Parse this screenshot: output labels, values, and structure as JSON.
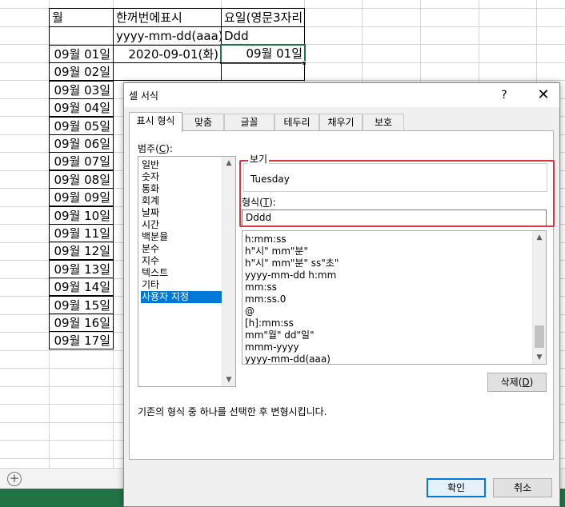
{
  "sheet": {
    "header_row": [
      "월",
      "한꺼번에표시",
      "요일(영문3자리)"
    ],
    "format_row": [
      "",
      "yyyy-mm-dd(aaa)",
      "Ddd"
    ],
    "dates": [
      "09월 01일",
      "09월 02일",
      "09월 03일",
      "09월 04일",
      "09월 05일",
      "09월 06일",
      "09월 07일",
      "09월 08일",
      "09월 09일",
      "09월 10일",
      "09월 11일",
      "09월 12일",
      "09월 13일",
      "09월 14일",
      "09월 15일",
      "09월 16일",
      "09월 17일"
    ],
    "row1_combined": "2020-09-01(화)",
    "row1_weekday": "09월 01일",
    "add_sheet_icon": "+"
  },
  "dialog": {
    "title": "셀 서식",
    "help": "?",
    "close": "✕",
    "tabs": [
      "표시 형식",
      "맞춤",
      "글꼴",
      "테두리",
      "채우기",
      "보호"
    ],
    "active_tab": "표시 형식",
    "category_label": "범주(",
    "category_key": "C",
    "category_label_end": "):",
    "categories": [
      "일반",
      "숫자",
      "통화",
      "회계",
      "날짜",
      "시간",
      "백분율",
      "분수",
      "지수",
      "텍스트",
      "기타",
      "사용자 지정"
    ],
    "selected_category": "사용자 지정",
    "preview_label": "보기",
    "preview_value": "Tuesday",
    "type_label": "형식(",
    "type_key": "T",
    "type_label_end": "):",
    "type_value": "Dddd",
    "format_codes": [
      "h:mm:ss",
      "h\"시\" mm\"분\"",
      "h\"시\" mm\"분\" ss\"초\"",
      "yyyy-mm-dd h:mm",
      "mm:ss",
      "mm:ss.0",
      "@",
      "[h]:mm:ss",
      "mm\"월\" dd\"일\"",
      "mmm-yyyy",
      "yyyy-mm-dd(aaa)"
    ],
    "delete_label": "삭제(",
    "delete_key": "D",
    "delete_label_end": ")",
    "description": "기존의 형식 중 하나를 선택한 후 변형시킵니다.",
    "ok": "확인",
    "cancel": "취소",
    "accent_color": "#0078d7",
    "highlight_color": "#d9363e"
  },
  "colors": {
    "excel_green": "#217346"
  }
}
